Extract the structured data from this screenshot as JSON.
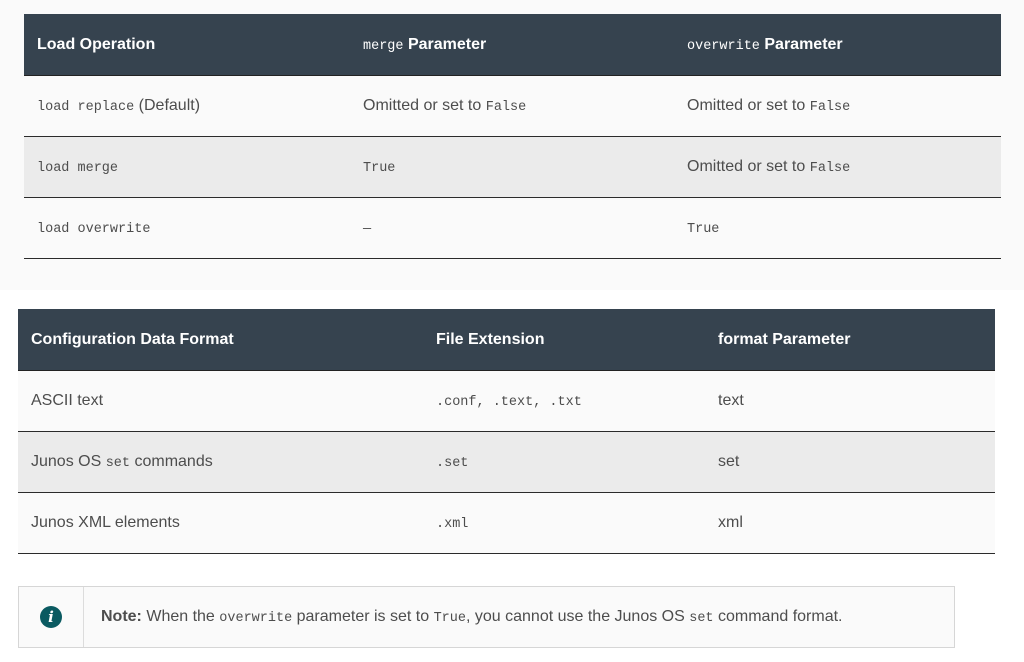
{
  "table1": {
    "headers": [
      {
        "code": "",
        "text": "Load Operation"
      },
      {
        "code": "merge",
        "text": " Parameter"
      },
      {
        "code": "overwrite",
        "text": " Parameter"
      }
    ],
    "rows": [
      {
        "op_code": "load replace",
        "op_text": " (Default)",
        "merge_text": "Omitted or set to ",
        "merge_code": "False",
        "overwrite_text": "Omitted or set to ",
        "overwrite_code": "False"
      },
      {
        "op_code": "load merge",
        "op_text": "",
        "merge_text": "",
        "merge_code": "True",
        "overwrite_text": "Omitted or set to ",
        "overwrite_code": "False"
      },
      {
        "op_code": "load overwrite",
        "op_text": "",
        "merge_text": "",
        "merge_code": "—",
        "overwrite_text": "",
        "overwrite_code": "True"
      }
    ]
  },
  "table2": {
    "headers": [
      "Configuration Data Format",
      "File Extension",
      "format Parameter"
    ],
    "rows": [
      {
        "format_pre": "ASCII text",
        "format_code": "",
        "format_post": "",
        "extension": ".conf, .text, .txt",
        "param": "text"
      },
      {
        "format_pre": "Junos OS ",
        "format_code": "set",
        "format_post": " commands",
        "extension": ".set",
        "param": "set"
      },
      {
        "format_pre": "Junos XML elements",
        "format_code": "",
        "format_post": "",
        "extension": ".xml",
        "param": "xml"
      }
    ]
  },
  "note": {
    "label": "Note:",
    "text1": " When the ",
    "code1": "overwrite",
    "text2": " parameter is set to ",
    "code2": "True",
    "text3": ", you cannot use the Junos OS ",
    "code3": "set",
    "text4": " command format."
  }
}
